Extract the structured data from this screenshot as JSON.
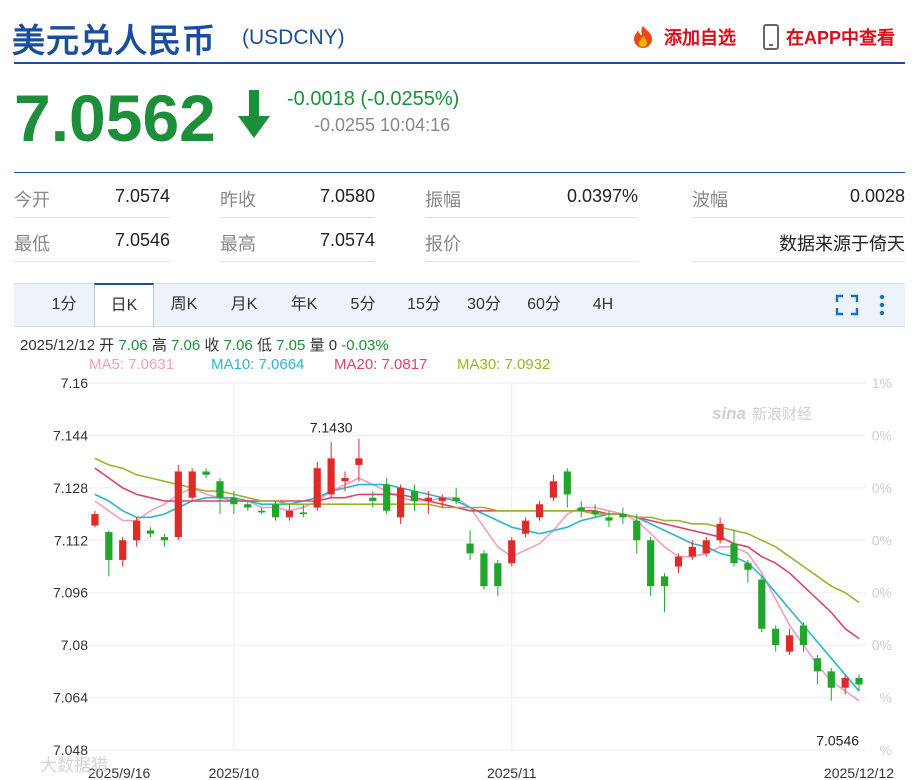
{
  "header": {
    "title": "美元兑人民币",
    "code": "(USDCNY)",
    "add_watch_label": "添加自选",
    "app_label": "在APP中查看"
  },
  "quote": {
    "price": "7.0562",
    "change": "-0.0018 (-0.0255%)",
    "sub_line": "-0.0255 10:04:16"
  },
  "stats": {
    "open_label": "今开",
    "open_value": "7.0574",
    "prev_close_label": "昨收",
    "prev_close_value": "7.0580",
    "amplitude_label": "振幅",
    "amplitude_value": "0.0397%",
    "wave_label": "波幅",
    "wave_value": "0.0028",
    "low_label": "最低",
    "low_value": "7.0546",
    "high_label": "最高",
    "high_value": "7.0574",
    "bid_label": "报价",
    "source_text": "数据来源于倚天"
  },
  "tabs": [
    "1分",
    "日K",
    "周K",
    "月K",
    "年K",
    "5分",
    "15分",
    "30分",
    "60分",
    "4H"
  ],
  "selected_tab": "日K",
  "kline_info": {
    "date": "2025/12/12",
    "open_label": "开",
    "open": "7.06",
    "high_label": "高",
    "high": "7.06",
    "close_label": "收",
    "close": "7.06",
    "low_label": "低",
    "low": "7.05",
    "vol_label": "量",
    "vol": "0",
    "pct": "-0.03%"
  },
  "ma": [
    {
      "label": "MA5: 7.0631",
      "color": "#f0a0b8"
    },
    {
      "label": "MA10: 7.0664",
      "color": "#2bb6cf"
    },
    {
      "label": "MA20: 7.0817",
      "color": "#d9456e"
    },
    {
      "label": "MA30: 7.0932",
      "color": "#9ab42a"
    }
  ],
  "colors": {
    "up": "#e02a2a",
    "down": "#22a52c",
    "brand": "#1a4e9c"
  },
  "watermarks": {
    "sina": "新浪财经",
    "corner": "大数据猎"
  },
  "chart_data": {
    "type": "candlestick",
    "ylim": [
      7.048,
      7.16
    ],
    "y_ticks": [
      "7.16",
      "7.144",
      "7.128",
      "7.112",
      "7.096",
      "7.08",
      "7.064",
      "7.048"
    ],
    "y_tick_values": [
      7.16,
      7.144,
      7.128,
      7.112,
      7.096,
      7.08,
      7.064,
      7.048
    ],
    "right_ticks": [
      "1%",
      "0%",
      "0%",
      "0%",
      "0%",
      "0%",
      "%",
      "%"
    ],
    "x_labels": [
      {
        "label": "2025/9/16",
        "index": 0
      },
      {
        "label": "2025/10",
        "index": 10
      },
      {
        "label": "2025/11",
        "index": 30
      },
      {
        "label": "2025/12/12",
        "index": 55
      }
    ],
    "annotations": [
      {
        "label": "7.1430",
        "index": 17,
        "value": 7.143
      },
      {
        "label": "7.0546",
        "index": 55,
        "value": 7.0546
      }
    ],
    "candles": [
      [
        7.1165,
        7.12,
        7.121,
        7.116
      ],
      [
        7.1145,
        7.106,
        7.115,
        7.101
      ],
      [
        7.106,
        7.112,
        7.113,
        7.104
      ],
      [
        7.112,
        7.118,
        7.119,
        7.11
      ],
      [
        7.115,
        7.114,
        7.116,
        7.113
      ],
      [
        7.113,
        7.112,
        7.114,
        7.11
      ],
      [
        7.113,
        7.133,
        7.135,
        7.112
      ],
      [
        7.125,
        7.133,
        7.134,
        7.124
      ],
      [
        7.133,
        7.132,
        7.134,
        7.131
      ],
      [
        7.13,
        7.125,
        7.131,
        7.12
      ],
      [
        7.125,
        7.123,
        7.127,
        7.12
      ],
      [
        7.123,
        7.122,
        7.124,
        7.121
      ],
      [
        7.121,
        7.1205,
        7.122,
        7.12
      ],
      [
        7.123,
        7.119,
        7.124,
        7.118
      ],
      [
        7.119,
        7.121,
        7.123,
        7.118
      ],
      [
        7.1205,
        7.12,
        7.123,
        7.119
      ],
      [
        7.122,
        7.134,
        7.136,
        7.121
      ],
      [
        7.126,
        7.137,
        7.142,
        7.125
      ],
      [
        7.13,
        7.131,
        7.133,
        7.127
      ],
      [
        7.135,
        7.137,
        7.143,
        7.13
      ],
      [
        7.125,
        7.124,
        7.127,
        7.122
      ],
      [
        7.129,
        7.121,
        7.131,
        7.12
      ],
      [
        7.119,
        7.128,
        7.129,
        7.117
      ],
      [
        7.127,
        7.124,
        7.129,
        7.121
      ],
      [
        7.124,
        7.125,
        7.127,
        7.12
      ],
      [
        7.124,
        7.125,
        7.126,
        7.122
      ],
      [
        7.125,
        7.124,
        7.128,
        7.123
      ],
      [
        7.111,
        7.108,
        7.115,
        7.106
      ],
      [
        7.108,
        7.098,
        7.109,
        7.097
      ],
      [
        7.105,
        7.098,
        7.106,
        7.095
      ],
      [
        7.105,
        7.112,
        7.113,
        7.104
      ],
      [
        7.114,
        7.118,
        7.119,
        7.113
      ],
      [
        7.119,
        7.123,
        7.124,
        7.118
      ],
      [
        7.125,
        7.13,
        7.132,
        7.124
      ],
      [
        7.133,
        7.126,
        7.134,
        7.122
      ],
      [
        7.122,
        7.121,
        7.124,
        7.119
      ],
      [
        7.121,
        7.12,
        7.123,
        7.119
      ],
      [
        7.119,
        7.118,
        7.121,
        7.116
      ],
      [
        7.12,
        7.119,
        7.122,
        7.117
      ],
      [
        7.118,
        7.112,
        7.12,
        7.108
      ],
      [
        7.112,
        7.098,
        7.113,
        7.095
      ],
      [
        7.101,
        7.098,
        7.102,
        7.09
      ],
      [
        7.104,
        7.107,
        7.108,
        7.102
      ],
      [
        7.107,
        7.11,
        7.112,
        7.106
      ],
      [
        7.108,
        7.112,
        7.113,
        7.107
      ],
      [
        7.112,
        7.117,
        7.119,
        7.111
      ],
      [
        7.111,
        7.105,
        7.115,
        7.104
      ],
      [
        7.105,
        7.103,
        7.106,
        7.099
      ],
      [
        7.1,
        7.085,
        7.101,
        7.084
      ],
      [
        7.085,
        7.08,
        7.086,
        7.078
      ],
      [
        7.078,
        7.083,
        7.085,
        7.077
      ],
      [
        7.086,
        7.08,
        7.087,
        7.078
      ],
      [
        7.076,
        7.072,
        7.077,
        7.068
      ],
      [
        7.072,
        7.067,
        7.073,
        7.063
      ],
      [
        7.067,
        7.07,
        7.071,
        7.065
      ],
      [
        7.07,
        7.068,
        7.071,
        7.066
      ]
    ],
    "ma_series": [
      {
        "name": "MA5",
        "values": [
          7.124,
          7.121,
          7.118,
          7.118,
          7.121,
          7.123,
          7.126,
          7.128,
          7.126,
          7.125,
          7.124,
          7.124,
          7.122,
          7.122,
          7.121,
          7.122,
          7.124,
          7.127,
          7.129,
          7.131,
          7.129,
          7.127,
          7.125,
          7.124,
          7.124,
          7.125,
          7.125,
          7.122,
          7.116,
          7.11,
          7.107,
          7.109,
          7.111,
          7.115,
          7.12,
          7.122,
          7.122,
          7.121,
          7.12,
          7.118,
          7.114,
          7.11,
          7.107,
          7.107,
          7.108,
          7.11,
          7.11,
          7.108,
          7.102,
          7.094,
          7.086,
          7.08,
          7.074,
          7.069,
          7.066,
          7.063
        ]
      },
      {
        "name": "MA10",
        "values": [
          7.126,
          7.124,
          7.121,
          7.119,
          7.119,
          7.12,
          7.122,
          7.124,
          7.125,
          7.125,
          7.125,
          7.124,
          7.123,
          7.123,
          7.123,
          7.124,
          7.125,
          7.127,
          7.128,
          7.129,
          7.129,
          7.129,
          7.128,
          7.127,
          7.126,
          7.125,
          7.124,
          7.122,
          7.12,
          7.118,
          7.116,
          7.115,
          7.114,
          7.115,
          7.116,
          7.118,
          7.119,
          7.12,
          7.12,
          7.119,
          7.117,
          7.115,
          7.113,
          7.111,
          7.11,
          7.108,
          7.107,
          7.105,
          7.101,
          7.096,
          7.091,
          7.086,
          7.081,
          7.076,
          7.071,
          7.066
        ]
      },
      {
        "name": "MA20",
        "values": [
          7.134,
          7.131,
          7.128,
          7.126,
          7.125,
          7.124,
          7.124,
          7.124,
          7.124,
          7.124,
          7.124,
          7.124,
          7.124,
          7.124,
          7.124,
          7.124,
          7.124,
          7.125,
          7.125,
          7.126,
          7.126,
          7.126,
          7.126,
          7.125,
          7.124,
          7.123,
          7.122,
          7.121,
          7.121,
          7.121,
          7.121,
          7.121,
          7.121,
          7.121,
          7.121,
          7.121,
          7.121,
          7.12,
          7.12,
          7.119,
          7.118,
          7.117,
          7.116,
          7.115,
          7.114,
          7.113,
          7.111,
          7.11,
          7.107,
          7.105,
          7.102,
          7.098,
          7.094,
          7.09,
          7.085,
          7.082
        ]
      },
      {
        "name": "MA30",
        "values": [
          7.137,
          7.135,
          7.134,
          7.132,
          7.131,
          7.13,
          7.129,
          7.128,
          7.127,
          7.127,
          7.126,
          7.125,
          7.124,
          7.124,
          7.123,
          7.123,
          7.123,
          7.123,
          7.123,
          7.123,
          7.123,
          7.123,
          7.123,
          7.123,
          7.123,
          7.122,
          7.122,
          7.122,
          7.122,
          7.121,
          7.121,
          7.121,
          7.121,
          7.121,
          7.121,
          7.121,
          7.12,
          7.12,
          7.12,
          7.119,
          7.119,
          7.118,
          7.118,
          7.117,
          7.117,
          7.116,
          7.115,
          7.114,
          7.112,
          7.11,
          7.107,
          7.104,
          7.101,
          7.098,
          7.096,
          7.093
        ]
      }
    ]
  }
}
